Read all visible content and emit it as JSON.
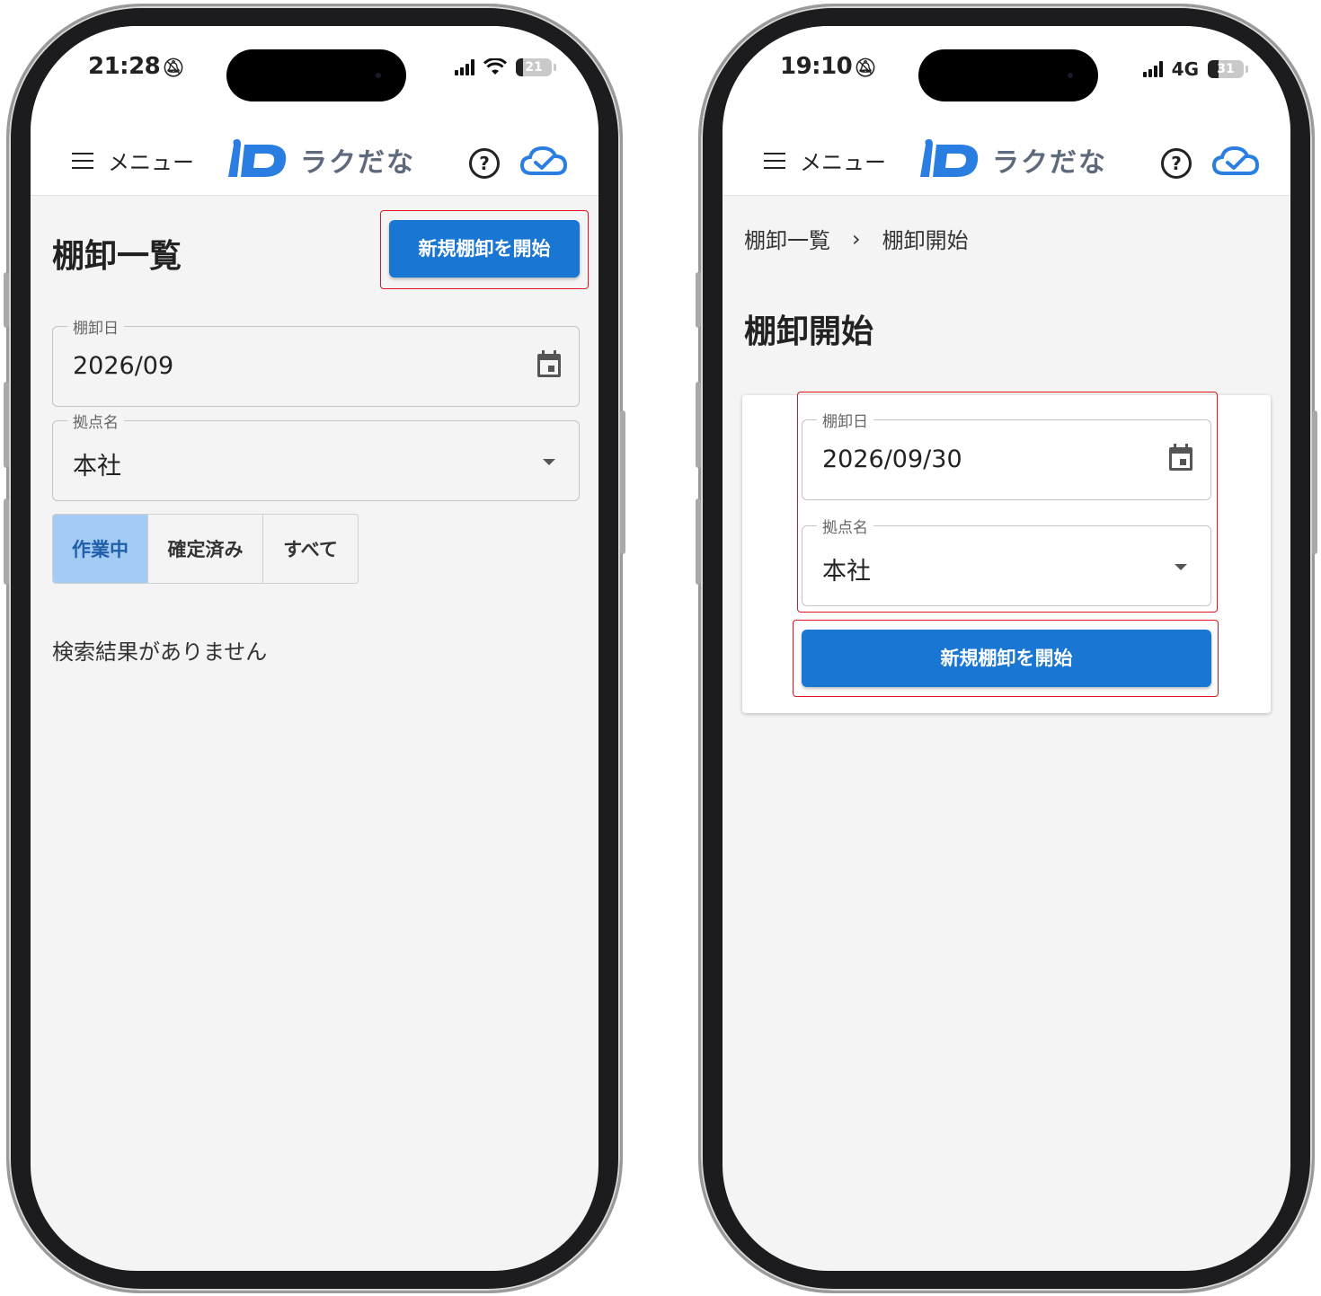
{
  "left": {
    "status": {
      "time": "21:28",
      "battery": "21",
      "battery_level": 0.21
    },
    "appbar": {
      "menu_label": "メニュー",
      "brand": "ラクだな"
    },
    "page_title": "棚卸一覧",
    "start_button": "新規棚卸を開始",
    "date_field": {
      "label": "棚卸日",
      "value": "2026/09"
    },
    "location_field": {
      "label": "拠点名",
      "value": "本社"
    },
    "filters": [
      "作業中",
      "確定済み",
      "すべて"
    ],
    "empty_message": "検索結果がありません"
  },
  "right": {
    "status": {
      "time": "19:10",
      "network": "4G",
      "battery": "31",
      "battery_level": 0.31
    },
    "appbar": {
      "menu_label": "メニュー",
      "brand": "ラクだな"
    },
    "breadcrumb": {
      "parent": "棚卸一覧",
      "separator": "›",
      "current": "棚卸開始"
    },
    "page_title": "棚卸開始",
    "date_field": {
      "label": "棚卸日",
      "value": "2026/09/30"
    },
    "location_field": {
      "label": "拠点名",
      "value": "本社"
    },
    "start_button": "新規棚卸を開始"
  },
  "colors": {
    "primary": "#1976d2",
    "brand_blue": "#2a7de1",
    "highlight_red": "#e0141e",
    "active_filter": "#a3cbf3"
  }
}
